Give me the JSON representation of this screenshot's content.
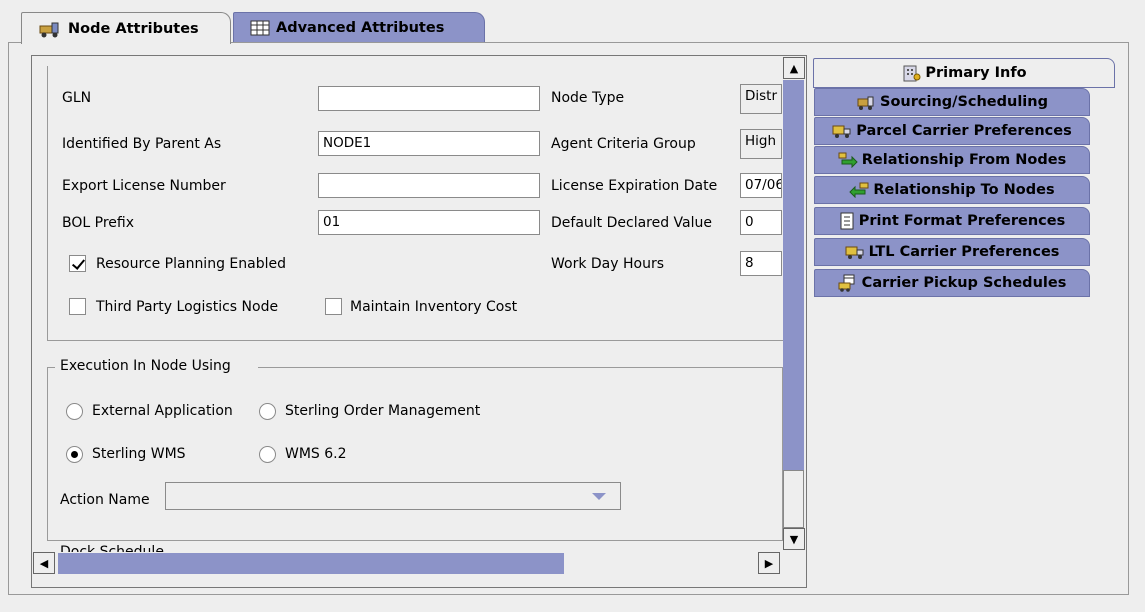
{
  "tabs": [
    {
      "label": "Node Attributes",
      "icon": "forklift-icon"
    },
    {
      "label": "Advanced Attributes",
      "icon": "table-icon"
    }
  ],
  "form": {
    "gln_label": "GLN",
    "gln_value": "",
    "identified_label": "Identified By Parent As",
    "identified_value": "NODE1",
    "export_label": "Export License Number",
    "export_value": "",
    "bol_label": "BOL Prefix",
    "bol_value": "01",
    "node_type_label": "Node Type",
    "node_type_value": "Distr",
    "agent_label": "Agent Criteria Group",
    "agent_value": "High",
    "license_exp_label": "License Expiration Date",
    "license_exp_value": "07/06",
    "declared_label": "Default Declared Value",
    "declared_value": "0",
    "workday_label": "Work Day Hours",
    "workday_value": "8",
    "resource_planning_label": "Resource Planning Enabled",
    "resource_planning_checked": true,
    "third_party_label": "Third Party Logistics Node",
    "third_party_checked": false,
    "maintain_inventory_label": "Maintain Inventory Cost",
    "maintain_inventory_checked": false
  },
  "execution": {
    "legend": "Execution In Node Using",
    "options": [
      {
        "label": "External Application",
        "checked": false
      },
      {
        "label": "Sterling Order Management",
        "checked": false
      },
      {
        "label": "Sterling WMS",
        "checked": true
      },
      {
        "label": "WMS 6.2",
        "checked": false
      }
    ],
    "action_label": "Action Name",
    "action_value": ""
  },
  "dock_schedule_label": "Dock Schedule",
  "side_tabs": [
    {
      "label": "Primary Info",
      "icon": "building-icon",
      "active": true
    },
    {
      "label": "Sourcing/Scheduling",
      "icon": "forklift-icon"
    },
    {
      "label": "Parcel Carrier Preferences",
      "icon": "truck-icon"
    },
    {
      "label": "Relationship From Nodes",
      "icon": "arrow-right-nodes-icon"
    },
    {
      "label": "Relationship To Nodes",
      "icon": "arrow-left-nodes-icon"
    },
    {
      "label": "Print Format Preferences",
      "icon": "document-icon"
    },
    {
      "label": "LTL Carrier Preferences",
      "icon": "truck-icon"
    },
    {
      "label": "Carrier Pickup Schedules",
      "icon": "calendar-truck-icon"
    }
  ],
  "colors": {
    "tab_inactive": "#8c93c8",
    "background": "#eeeeee",
    "scroll_track": "#8c93c8"
  }
}
